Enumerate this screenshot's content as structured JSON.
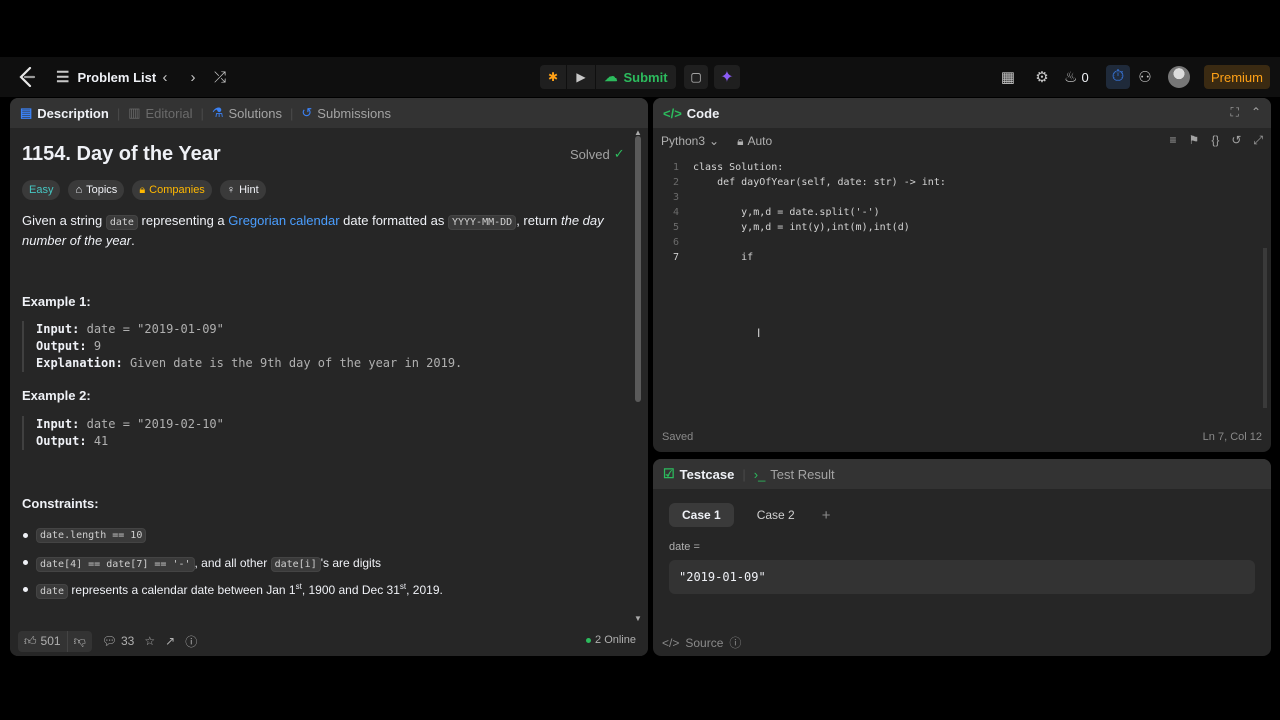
{
  "nav": {
    "problem_list": "Problem List",
    "submit": "Submit",
    "streak_count": "0",
    "premium": "Premium"
  },
  "tabs": {
    "description": "Description",
    "editorial": "Editorial",
    "solutions": "Solutions",
    "submissions": "Submissions"
  },
  "problem": {
    "title": "1154. Day of the Year",
    "status": "Solved",
    "difficulty": "Easy",
    "topics": "Topics",
    "companies": "Companies",
    "hint": "Hint",
    "desc_1": "Given a string ",
    "desc_date": "date",
    "desc_2": " representing a ",
    "desc_link": "Gregorian calendar",
    "desc_3": " date formatted as ",
    "desc_fmt": "YYYY-MM-DD",
    "desc_4": ", return ",
    "desc_5": "the day number of the year",
    "desc_6": "."
  },
  "examples": [
    {
      "heading": "Example 1:",
      "input_label": "Input:",
      "input": "date = \"2019-01-09\"",
      "output_label": "Output:",
      "output": "9",
      "explanation_label": "Explanation:",
      "explanation": "Given date is the 9th day of the year in 2019."
    },
    {
      "heading": "Example 2:",
      "input_label": "Input:",
      "input": "date = \"2019-02-10\"",
      "output_label": "Output:",
      "output": "41"
    }
  ],
  "constraints": {
    "heading": "Constraints:",
    "c1_code": "date.length == 10",
    "c2_code_a": "date[4] == date[7] == '-'",
    "c2_text": ", and all other ",
    "c2_code_b": "date[i]",
    "c2_text_b": "'s are digits",
    "c3_code": "date",
    "c3_text_a": " represents a calendar date between Jan 1",
    "c3_sup_a": "st",
    "c3_text_b": ", 1900 and Dec 31",
    "c3_sup_b": "st",
    "c3_text_c": ", 2019."
  },
  "footer": {
    "likes": "501",
    "comments": "33",
    "online": "2 Online"
  },
  "code_panel": {
    "title": "Code",
    "language": "Python3",
    "mode": "Auto",
    "status": "Saved",
    "position": "Ln 7, Col 12",
    "lines": [
      {
        "n": "1",
        "text": "class Solution:"
      },
      {
        "n": "2",
        "text": "    def dayOfYear(self, date: str) -> int:"
      },
      {
        "n": "3",
        "text": ""
      },
      {
        "n": "4",
        "text": "        y,m,d = date.split('-')"
      },
      {
        "n": "5",
        "text": "        y,m,d = int(y),int(m),int(d)"
      },
      {
        "n": "6",
        "text": ""
      },
      {
        "n": "7",
        "text": "        if"
      }
    ]
  },
  "test_panel": {
    "testcase_tab": "Testcase",
    "result_tab": "Test Result",
    "case1": "Case 1",
    "case2": "Case 2",
    "var_label": "date =",
    "var_value": "\"2019-01-09\"",
    "source": "Source"
  }
}
